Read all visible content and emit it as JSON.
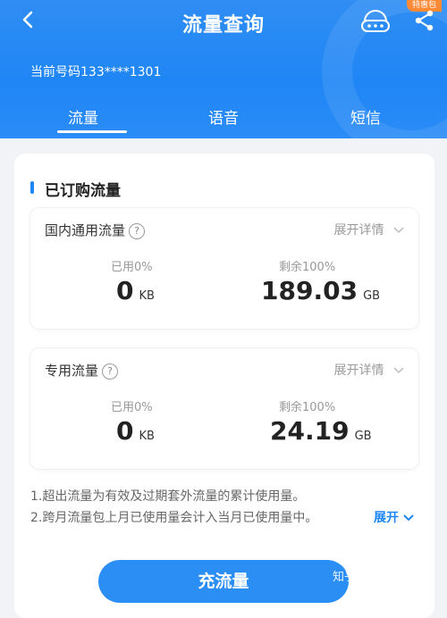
{
  "header": {
    "title": "流量查询",
    "badge": "特惠包",
    "phone": "当前号码133****1301",
    "tabs": [
      {
        "label": "流量"
      },
      {
        "label": "语音"
      },
      {
        "label": "短信"
      }
    ],
    "accent": "#1f86f5"
  },
  "subscribed": {
    "title": "已订购流量",
    "plans": [
      {
        "name": "国内通用流量",
        "expand": "展开详情",
        "used_label": "已用0%",
        "used_value": "0",
        "used_unit": "KB",
        "remain_label": "剩余100%",
        "remain_value": "189.03",
        "remain_unit": "GB"
      },
      {
        "name": "专用流量",
        "expand": "展开详情",
        "used_label": "已用0%",
        "used_value": "0",
        "used_unit": "KB",
        "remain_label": "剩余100%",
        "remain_value": "24.19",
        "remain_unit": "GB"
      }
    ]
  },
  "notes": {
    "line1": "1.超出流量为有效及过期套外流量的累计使用量。",
    "line2": "2.跨月流量包上月已使用量会计入当月已使用量中。",
    "expand_label": "展开"
  },
  "footer": {
    "recharge_label": "充流量",
    "watermark": "知乎 @套餐雷达"
  }
}
